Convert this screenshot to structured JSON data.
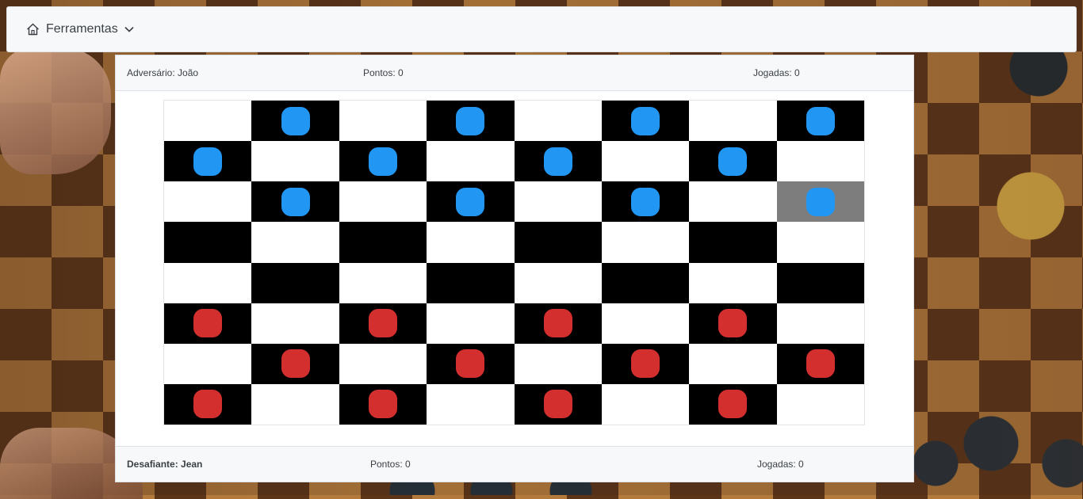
{
  "toolbar": {
    "menu_label": "Ferramentas",
    "home_icon": "home-icon",
    "chevron_icon": "chevron-down-icon"
  },
  "opponent": {
    "label": "Adversário: João",
    "points": "Pontos: 0",
    "moves": "Jogadas: 0"
  },
  "challenger": {
    "label": "Desafiante: Jean",
    "points": "Pontos: 0",
    "moves": "Jogadas: 0"
  },
  "board": {
    "dark_color": "#000000",
    "light_color": "#ffffff",
    "selected_color": "#7d7d7d",
    "piece_colors": {
      "b": "#2196f3",
      "r": "#d32f2f"
    },
    "selected_square": {
      "row": 2,
      "col": 7
    },
    "rows": [
      [
        "",
        "b",
        "",
        "b",
        "",
        "b",
        "",
        "b"
      ],
      [
        "b",
        "",
        "b",
        "",
        "b",
        "",
        "b",
        ""
      ],
      [
        "",
        "b",
        "",
        "b",
        "",
        "b",
        "",
        "b"
      ],
      [
        "",
        "",
        "",
        "",
        "",
        "",
        "",
        ""
      ],
      [
        "",
        "",
        "",
        "",
        "",
        "",
        "",
        ""
      ],
      [
        "r",
        "",
        "r",
        "",
        "r",
        "",
        "r",
        ""
      ],
      [
        "",
        "r",
        "",
        "r",
        "",
        "r",
        "",
        "r"
      ],
      [
        "r",
        "",
        "r",
        "",
        "r",
        "",
        "r",
        ""
      ]
    ]
  }
}
